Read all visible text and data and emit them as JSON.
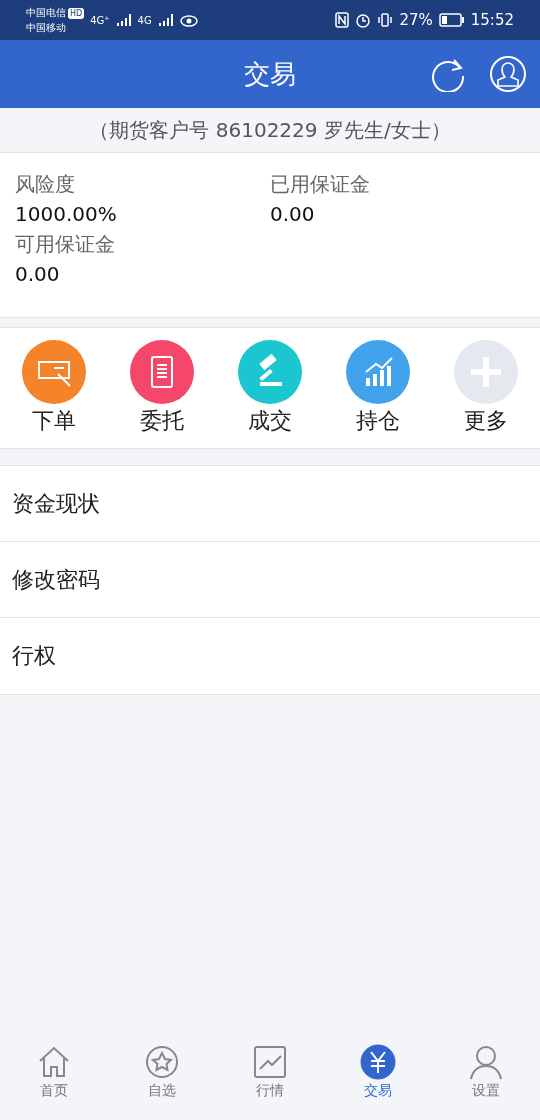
{
  "status_bar": {
    "carrier_1": "中国电信",
    "carrier_1_badge": "HD",
    "carrier_2": "中国移动",
    "signal_1_label": "4G⁺",
    "signal_2_label": "4G",
    "battery": "27%",
    "time": "15:52"
  },
  "header": {
    "title": "交易"
  },
  "account": {
    "text": "（期货客户号 86102229 罗先生/女士）"
  },
  "summary": [
    {
      "label": "风险度",
      "value": "1000.00%"
    },
    {
      "label": "已用保证金",
      "value": "0.00"
    },
    {
      "label": "可用保证金",
      "value": "0.00"
    }
  ],
  "actions": [
    {
      "kind": "order",
      "label": "下单",
      "color": "#f5832a"
    },
    {
      "kind": "entrust",
      "label": "委托",
      "color": "#f5476a"
    },
    {
      "kind": "deal",
      "label": "成交",
      "color": "#1cc6d0"
    },
    {
      "kind": "position",
      "label": "持仓",
      "color": "#42a2ec"
    },
    {
      "kind": "more",
      "label": "更多",
      "color": "#e4e8ef"
    }
  ],
  "menu": [
    "资金现状",
    "修改密码",
    "行权"
  ],
  "tabs": [
    {
      "kind": "home",
      "label": "首页",
      "selected": false
    },
    {
      "kind": "star",
      "label": "自选",
      "selected": false
    },
    {
      "kind": "chart",
      "label": "行情",
      "selected": false
    },
    {
      "kind": "yen",
      "label": "交易",
      "selected": true
    },
    {
      "kind": "user",
      "label": "设置",
      "selected": false
    }
  ]
}
